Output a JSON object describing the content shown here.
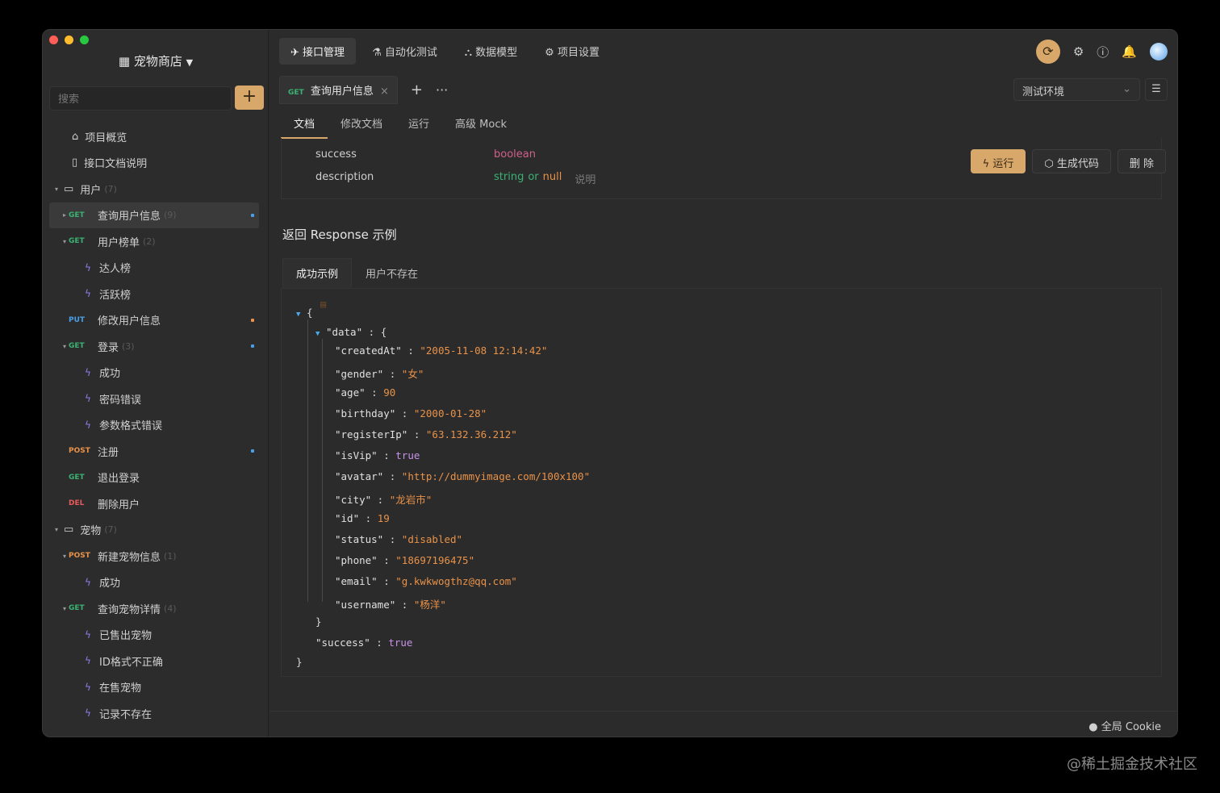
{
  "window": {
    "traffic_colors": [
      "#ff5f57",
      "#febc2e",
      "#28c840"
    ],
    "project_name": "宠物商店",
    "accent": "#d8a86b"
  },
  "sidebar": {
    "search_placeholder": "搜索",
    "add_label": "+",
    "tree": [
      {
        "label": "项目概览",
        "icon": "bank-icon",
        "indent": 1,
        "kind": "folderish"
      },
      {
        "label": "接口文档说明",
        "icon": "doc-icon",
        "indent": 1,
        "kind": "folderish"
      },
      {
        "label": "用户",
        "icon": "folder-icon",
        "indent": 0,
        "kind": "folder",
        "count": "(7)",
        "caret": "▾"
      },
      {
        "label": "查询用户信息",
        "method": "GET",
        "indent": 1,
        "kind": "api",
        "count": "(9)",
        "caret": "▸",
        "active": true,
        "dot": "#4a9ee8"
      },
      {
        "label": "用户榜单",
        "method": "GET",
        "indent": 1,
        "kind": "api",
        "count": "(2)",
        "caret": "▾"
      },
      {
        "label": "达人榜",
        "indent": 2,
        "kind": "case"
      },
      {
        "label": "活跃榜",
        "indent": 2,
        "kind": "case"
      },
      {
        "label": "修改用户信息",
        "method": "PUT",
        "indent": 1,
        "kind": "api",
        "dot": "#e8924a"
      },
      {
        "label": "登录",
        "method": "GET",
        "indent": 1,
        "kind": "api",
        "count": "(3)",
        "caret": "▾",
        "dot": "#4a9ee8"
      },
      {
        "label": "成功",
        "indent": 2,
        "kind": "case"
      },
      {
        "label": "密码错误",
        "indent": 2,
        "kind": "case"
      },
      {
        "label": "参数格式错误",
        "indent": 2,
        "kind": "case"
      },
      {
        "label": "注册",
        "method": "POST",
        "indent": 1,
        "kind": "api",
        "dot": "#4a9ee8"
      },
      {
        "label": "退出登录",
        "method": "GET",
        "indent": 1,
        "kind": "api"
      },
      {
        "label": "删除用户",
        "method": "DEL",
        "indent": 1,
        "kind": "api"
      },
      {
        "label": "宠物",
        "icon": "folder-icon",
        "indent": 0,
        "kind": "folder",
        "count": "(7)",
        "caret": "▾"
      },
      {
        "label": "新建宠物信息",
        "method": "POST",
        "indent": 1,
        "kind": "api",
        "count": "(1)",
        "caret": "▾"
      },
      {
        "label": "成功",
        "indent": 2,
        "kind": "case"
      },
      {
        "label": "查询宠物详情",
        "method": "GET",
        "indent": 1,
        "kind": "api",
        "count": "(4)",
        "caret": "▾"
      },
      {
        "label": "已售出宠物",
        "indent": 2,
        "kind": "case"
      },
      {
        "label": "ID格式不正确",
        "indent": 2,
        "kind": "case"
      },
      {
        "label": "在售宠物",
        "indent": 2,
        "kind": "case"
      },
      {
        "label": "记录不存在",
        "indent": 2,
        "kind": "case"
      }
    ]
  },
  "topnav": {
    "tabs": [
      {
        "label": "接口管理",
        "icon": "rocket-icon",
        "active": true
      },
      {
        "label": "自动化测试",
        "icon": "flask-icon"
      },
      {
        "label": "数据模型",
        "icon": "model-icon"
      },
      {
        "label": "项目设置",
        "icon": "gear-icon"
      }
    ]
  },
  "doctab": {
    "method": "GET",
    "title": "查询用户信息",
    "close": "×",
    "add": "+",
    "more": "···"
  },
  "env": {
    "selected": "测试环境"
  },
  "subtabs": [
    {
      "label": "文档",
      "active": true
    },
    {
      "label": "修改文档"
    },
    {
      "label": "运行"
    },
    {
      "label": "高级 Mock"
    }
  ],
  "schema_rows": [
    {
      "key": "success",
      "type": "boolean",
      "type_color": "#d0608a",
      "null": "",
      "desc": ""
    },
    {
      "key": "description",
      "type": "string",
      "type_color": "#3bb273",
      "or": "or",
      "null": "null",
      "desc": "说明"
    }
  ],
  "actions": {
    "run": "运行",
    "gen": "生成代码",
    "del": "删 除"
  },
  "response": {
    "title": "返回 Response 示例",
    "tabs": [
      {
        "label": "成功示例",
        "active": true
      },
      {
        "label": "用户不存在"
      }
    ],
    "json": [
      {
        "indent": 0,
        "text": "{",
        "tri": true
      },
      {
        "indent": 1,
        "key": "\"data\"",
        "text": "{",
        "tri": true
      },
      {
        "indent": 2,
        "key": "\"createdAt\"",
        "val": "\"2005-11-08 12:14:42\"",
        "vtype": "str"
      },
      {
        "indent": 2,
        "key": "\"gender\"",
        "val": "\"女\"",
        "vtype": "str"
      },
      {
        "indent": 2,
        "key": "\"age\"",
        "val": "90",
        "vtype": "num"
      },
      {
        "indent": 2,
        "key": "\"birthday\"",
        "val": "\"2000-01-28\"",
        "vtype": "str"
      },
      {
        "indent": 2,
        "key": "\"registerIp\"",
        "val": "\"63.132.36.212\"",
        "vtype": "str"
      },
      {
        "indent": 2,
        "key": "\"isVip\"",
        "val": "true",
        "vtype": "bool"
      },
      {
        "indent": 2,
        "key": "\"avatar\"",
        "val": "\"http://dummyimage.com/100x100\"",
        "vtype": "str"
      },
      {
        "indent": 2,
        "key": "\"city\"",
        "val": "\"龙岩市\"",
        "vtype": "str"
      },
      {
        "indent": 2,
        "key": "\"id\"",
        "val": "19",
        "vtype": "num"
      },
      {
        "indent": 2,
        "key": "\"status\"",
        "val": "\"disabled\"",
        "vtype": "str"
      },
      {
        "indent": 2,
        "key": "\"phone\"",
        "val": "\"18697196475\"",
        "vtype": "str"
      },
      {
        "indent": 2,
        "key": "\"email\"",
        "val": "\"g.kwkwogthz@qq.com\"",
        "vtype": "str"
      },
      {
        "indent": 2,
        "key": "\"username\"",
        "val": "\"杨洋\"",
        "vtype": "str"
      },
      {
        "indent": 1,
        "text": "}"
      },
      {
        "indent": 1,
        "key": "\"success\"",
        "val": "true",
        "vtype": "bool"
      },
      {
        "indent": 0,
        "text": "}"
      }
    ]
  },
  "footer": {
    "cookie": "全局 Cookie"
  },
  "watermark": "@稀土掘金技术社区"
}
